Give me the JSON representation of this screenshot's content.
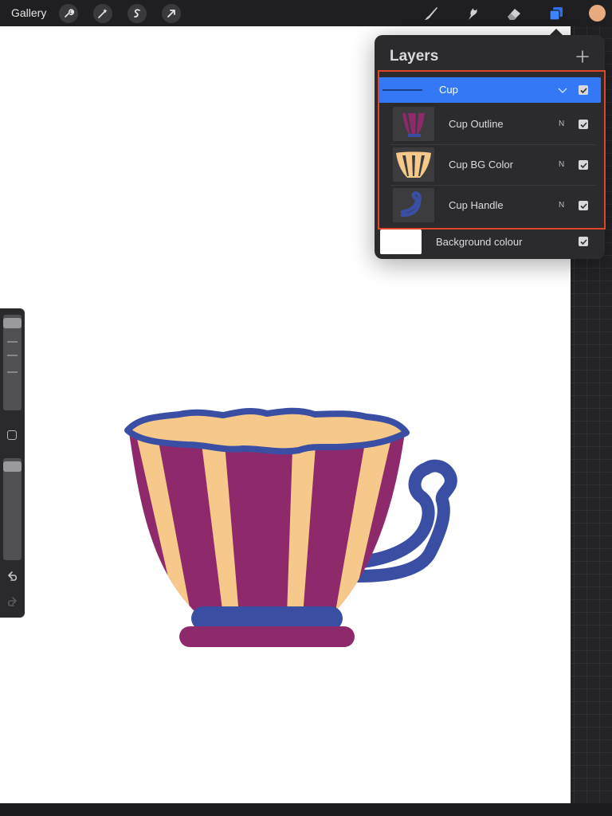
{
  "topbar": {
    "gallery_label": "Gallery",
    "left_tools": [
      "wrench-icon",
      "magic-wand-icon",
      "selection-icon",
      "transform-arrow-icon"
    ],
    "right_tools": [
      "brush-icon",
      "smudge-icon",
      "eraser-icon",
      "layers-icon"
    ],
    "current_color": "#e8ab7f"
  },
  "sidebar": {
    "tools": [
      "brush-size-slider",
      "modify-button",
      "opacity-slider",
      "undo-icon",
      "redo-icon"
    ]
  },
  "layers_panel": {
    "title": "Layers",
    "add_icon": "plus-icon",
    "group": {
      "name": "Cup",
      "selected": true,
      "expanded": true,
      "visible": true
    },
    "sublayers": [
      {
        "name": "Cup Outline",
        "blend_mode": "N",
        "visible": true
      },
      {
        "name": "Cup BG Color",
        "blend_mode": "N",
        "visible": true
      },
      {
        "name": "Cup Handle",
        "blend_mode": "N",
        "visible": true
      }
    ],
    "background": {
      "name": "Background colour",
      "visible": true,
      "color": "#ffffff"
    }
  },
  "colors": {
    "accent": "#3478f6",
    "highlight": "#e0452c",
    "cup_purple": "#8e2a6b",
    "cup_peach": "#f6c98a",
    "cup_blue": "#3a4fa3"
  }
}
